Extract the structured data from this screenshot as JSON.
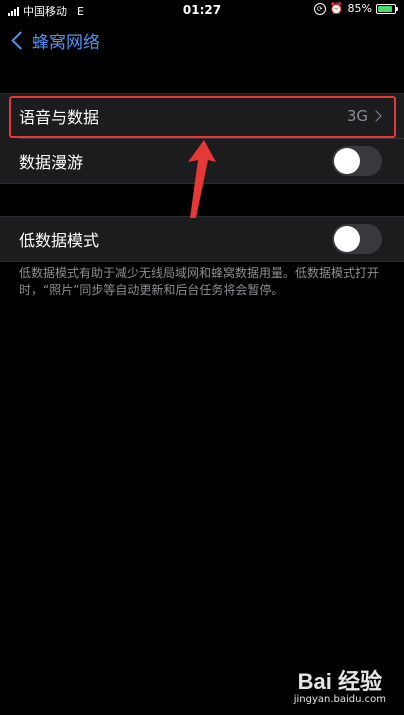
{
  "status_bar": {
    "carrier": "中国移动",
    "network": "E",
    "time": "01:27",
    "battery_text": "85%",
    "battery_level": 0.85,
    "battery_color": "#4cd964"
  },
  "nav": {
    "back_label": "蜂窝网络"
  },
  "groups": {
    "voice_data_label": "语音与数据",
    "voice_data_value": "3G",
    "roaming_label": "数据漫游",
    "roaming_on": false,
    "low_data_label": "低数据模式",
    "low_data_on": false
  },
  "footer": {
    "text": "低数据模式有助于减少无线局域网和蜂窝数据用量。低数据模式打开时，“照片”同步等自动更新和后台任务将会暂停。"
  },
  "watermark": {
    "logo": "Bai 经验",
    "url": "jingyan.baidu.com"
  },
  "colors": {
    "accent": "#4c93f5",
    "highlight": "#e53935"
  }
}
